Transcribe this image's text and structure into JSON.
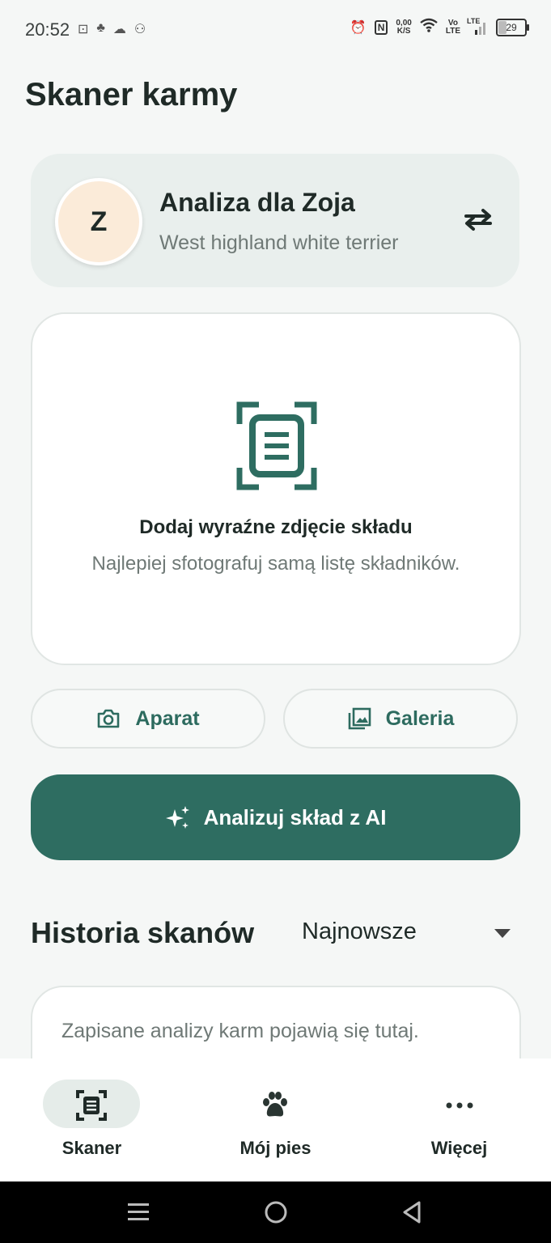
{
  "status_bar": {
    "time": "20:52",
    "net_speed_value": "0,00",
    "net_speed_unit": "K/S",
    "network_top": "Vo",
    "network_bottom": "LTE",
    "lte_label": "LTE",
    "battery_level": "29"
  },
  "header": {
    "title": "Skaner karmy"
  },
  "dog_card": {
    "avatar_letter": "Z",
    "title": "Analiza dla Zoja",
    "breed": "West highland white terrier"
  },
  "upload": {
    "title": "Dodaj wyraźne zdjęcie składu",
    "hint": "Najlepiej sfotografuj samą listę składników."
  },
  "buttons": {
    "camera": "Aparat",
    "gallery": "Galeria",
    "analyze": "Analizuj skład z AI"
  },
  "history": {
    "title": "Historia skanów",
    "sort_selected": "Najnowsze",
    "empty_message": "Zapisane analizy karm pojawią się tutaj."
  },
  "bottom_nav": {
    "items": [
      {
        "label": "Skaner",
        "icon": "scanner-icon",
        "active": true
      },
      {
        "label": "Mój pies",
        "icon": "paw-icon",
        "active": false
      },
      {
        "label": "Więcej",
        "icon": "more-icon",
        "active": false
      }
    ]
  },
  "colors": {
    "accent": "#2e6d61",
    "background": "#f5f7f6",
    "avatar_bg": "#fbebd9"
  }
}
